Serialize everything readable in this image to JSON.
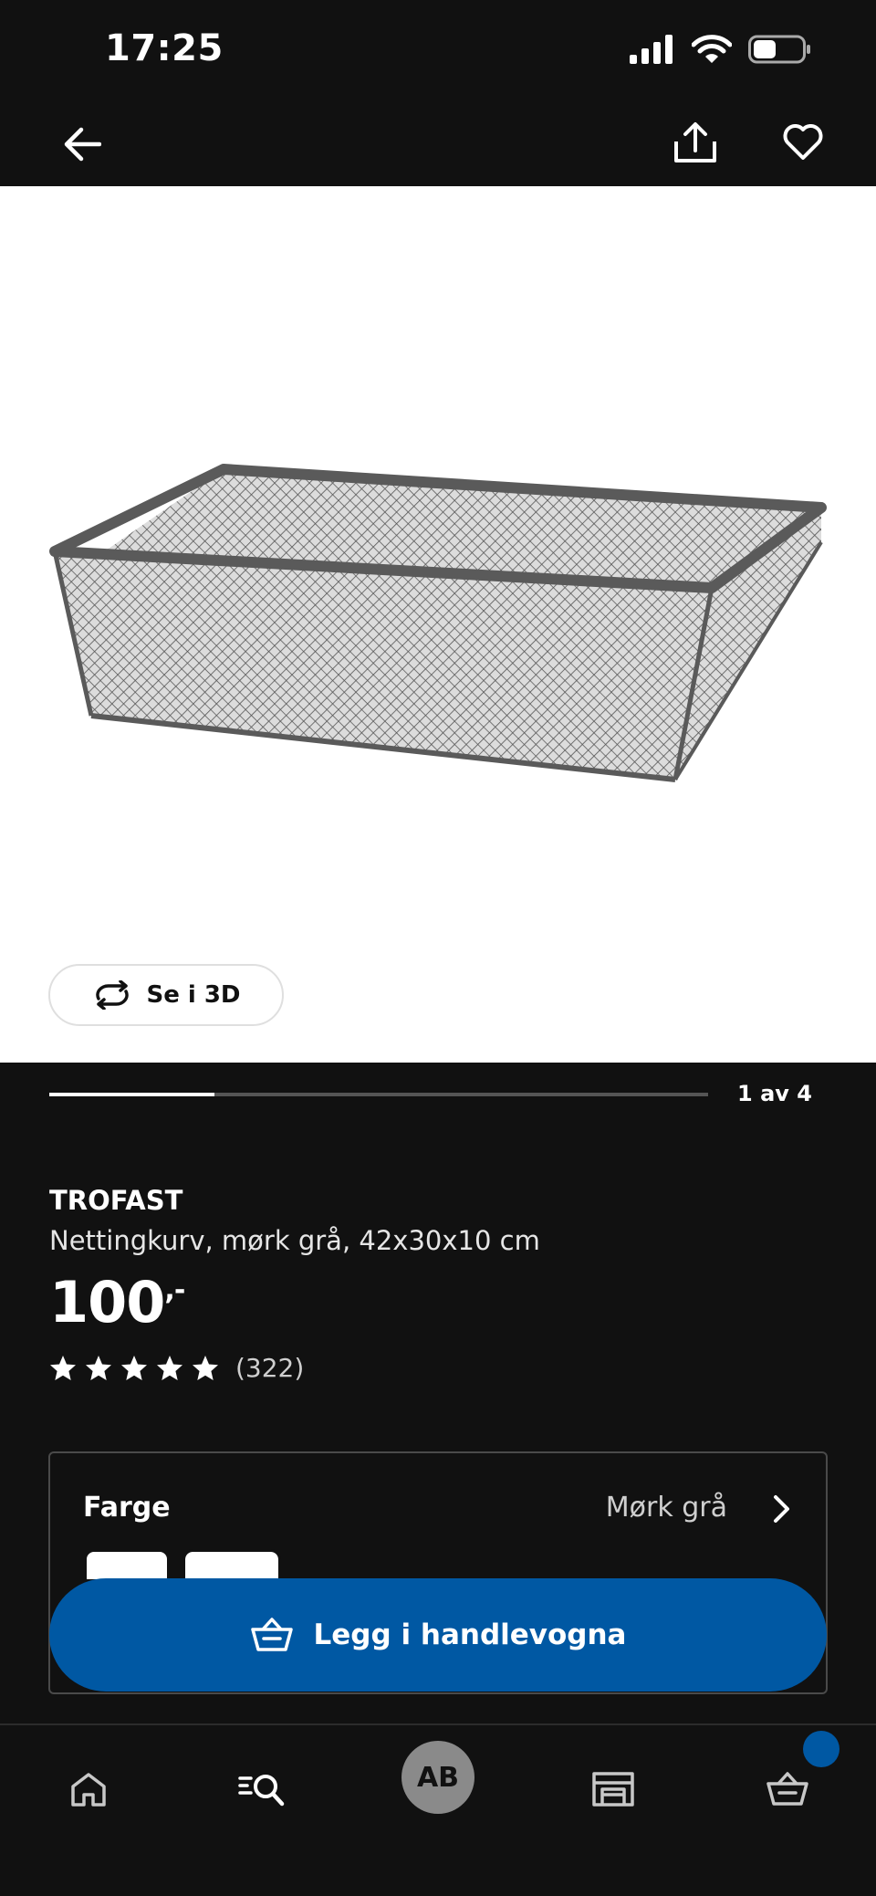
{
  "status_bar": {
    "time": "17:25"
  },
  "product": {
    "brand": "TROFAST",
    "description": "Nettingkurv, mørk grå, 42x30x10 cm",
    "price": "100",
    "price_suffix": ",-",
    "rating_stars": 5,
    "rating_count": "(322)"
  },
  "gallery": {
    "view_3d_label": "Se i 3D",
    "counter": "1 av 4",
    "progress_fraction": 0.25
  },
  "color_selector": {
    "label": "Farge",
    "value": "Mørk grå"
  },
  "cta": {
    "label": "Legg i handlevogna"
  },
  "bottom_nav": {
    "avatar_initials": "AB"
  },
  "colors": {
    "background": "#111111",
    "accent_blue": "#0058a3",
    "product_grey": "#5a5a5a"
  },
  "icons": [
    "back-arrow-icon",
    "share-icon",
    "heart-icon",
    "rotate-3d-icon",
    "star-icon",
    "chevron-right-icon",
    "basket-icon",
    "home-icon",
    "search-icon",
    "store-icon",
    "cart-icon"
  ]
}
